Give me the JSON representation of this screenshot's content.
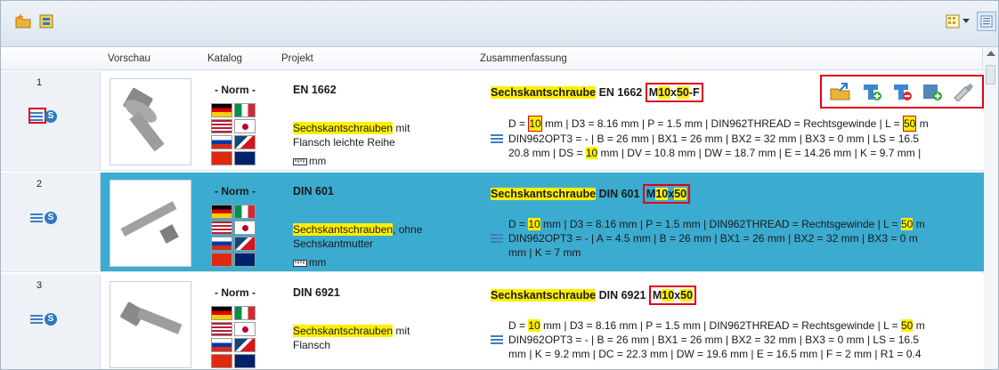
{
  "header": {
    "columns": [
      "Vorschau",
      "Katalog",
      "Projekt",
      "Zusammenfassung"
    ]
  },
  "toolbar": {
    "left_icons": [
      "open-folder-star-icon",
      "catalog-icon"
    ],
    "right_icons": [
      "view-grid-icon",
      "dropdown-arrow-icon",
      "details-view-icon"
    ]
  },
  "rows": [
    {
      "num": "1",
      "catalog": "- Norm -",
      "project_title": "EN 1662",
      "desc_hl": "Sechskantschrauben",
      "desc_rest": " mit",
      "desc_line2": "Flansch leichte Reihe",
      "mm": "mm",
      "sum_hl": "Sechskantschraube",
      "sum_mid": " EN 1662 ",
      "sum_m": "M",
      "sum_v1": "10",
      "sum_x": "x",
      "sum_v2": "50",
      "sum_suffix": "-F",
      "line1_a": "D = ",
      "line1_v": "10",
      "line1_b": " mm | D3 = 8.16 mm | P = 1.5 mm | DIN962THREAD = Rechtsgewinde | L = ",
      "line1_v2": "50",
      "line1_c": " m",
      "line2": "DIN962OPT3 = - | B = 26 mm | BX1 = 26 mm | BX2 = 32 mm | BX3 = 0 mm | LS = 16.5",
      "line3_a": "20.8 mm | DS = ",
      "line3_v": "10",
      "line3_b": " mm | DV = 10.8 mm | DW = 18.7 mm | E = 14.26 mm | K = 9.7 mm |"
    },
    {
      "num": "2",
      "catalog": "- Norm -",
      "project_title": "DIN 601",
      "desc_hl": "Sechskantschrauben",
      "desc_rest": ", ohne",
      "desc_line2": "Sechskantmutter",
      "mm": "mm",
      "sum_hl": "Sechskantschraube",
      "sum_mid": " DIN 601 ",
      "sum_m": "M",
      "sum_v1": "10",
      "sum_x": "x",
      "sum_v2": "50",
      "sum_suffix": "",
      "line1_a": "D = ",
      "line1_v": "10",
      "line1_b": " mm | D3 = 8.16 mm | P = 1.5 mm | DIN962THREAD = Rechtsgewinde | L = ",
      "line1_v2": "50",
      "line1_c": " m",
      "line2": "DIN962OPT3 = - | A = 4.5 mm | B = 26 mm | BX1 = 26 mm | BX2 = 32 mm | BX3 = 0 m",
      "line3_a": "mm | K = 7 mm",
      "line3_v": "",
      "line3_b": ""
    },
    {
      "num": "3",
      "catalog": "- Norm -",
      "project_title": "DIN 6921",
      "desc_hl": "Sechskantschrauben",
      "desc_rest": " mit",
      "desc_line2": "Flansch",
      "mm": "mm",
      "sum_hl": "Sechskantschraube",
      "sum_mid": " DIN 6921 ",
      "sum_m": "M",
      "sum_v1": "10",
      "sum_x": "x",
      "sum_v2": "50",
      "sum_suffix": "",
      "line1_a": "D = ",
      "line1_v": "10",
      "line1_b": " mm | D3 = 8.16 mm | P = 1.5 mm | DIN962THREAD = Rechtsgewinde | L = ",
      "line1_v2": "50",
      "line1_c": " m",
      "line2": "DIN962OPT3 = - | B = 26 mm | BX1 = 26 mm | BX2 = 32 mm | BX3 = 0 mm | LS = 16.5",
      "line3_a": "mm | K = 9.2 mm | DC = 22.3 mm | DW = 19.6 mm | E = 16.5 mm | F = 2 mm | R1 = 0.4",
      "line3_v": "",
      "line3_b": ""
    }
  ],
  "row_actions": [
    "open-in-folder-icon",
    "add-to-assembly-icon",
    "replace-part-icon",
    "export-icon",
    "search-similar-icon"
  ],
  "colors": {
    "selected_row": "#3cabd0",
    "highlight": "#ffef00",
    "annotation_red": "#e0001a"
  }
}
